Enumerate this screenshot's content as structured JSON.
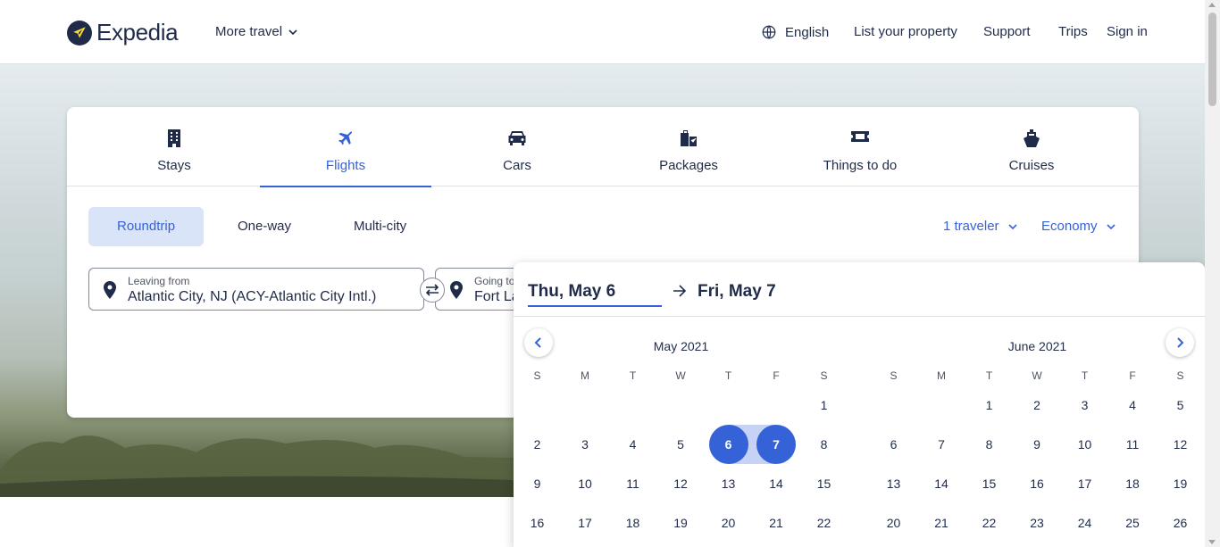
{
  "header": {
    "logo_text": "Expedia",
    "more_travel": "More travel",
    "language": "English",
    "list_property": "List your property",
    "support": "Support",
    "trips": "Trips",
    "sign_in": "Sign in"
  },
  "tabs": [
    {
      "label": "Stays",
      "icon": "building-icon"
    },
    {
      "label": "Flights",
      "icon": "plane-icon",
      "active": true
    },
    {
      "label": "Cars",
      "icon": "car-icon"
    },
    {
      "label": "Packages",
      "icon": "packages-icon"
    },
    {
      "label": "Things to do",
      "icon": "ticket-icon"
    },
    {
      "label": "Cruises",
      "icon": "ship-icon"
    }
  ],
  "trip_types": {
    "roundtrip": "Roundtrip",
    "oneway": "One-way",
    "multicity": "Multi-city"
  },
  "options": {
    "travelers": "1 traveler",
    "cabin": "Economy"
  },
  "leaving": {
    "label": "Leaving from",
    "value": "Atlantic City, NJ (ACY-Atlantic City Intl.)"
  },
  "going": {
    "label": "Going to",
    "value": "Fort Lauderdale"
  },
  "picker": {
    "start_date": "Thu, May 6",
    "end_date": "Fri, May 7",
    "weekdays": [
      "S",
      "M",
      "T",
      "W",
      "T",
      "F",
      "S"
    ],
    "months": [
      {
        "title": "May 2021",
        "weeks": [
          [
            "",
            "",
            "",
            "",
            "",
            "",
            "1"
          ],
          [
            "2",
            "3",
            "4",
            "5",
            "6",
            "7",
            "8"
          ],
          [
            "9",
            "10",
            "11",
            "12",
            "13",
            "14",
            "15"
          ],
          [
            "16",
            "17",
            "18",
            "19",
            "20",
            "21",
            "22"
          ]
        ]
      },
      {
        "title": "June 2021",
        "weeks": [
          [
            "",
            "",
            "1",
            "2",
            "3",
            "4",
            "5"
          ],
          [
            "6",
            "7",
            "8",
            "9",
            "10",
            "11",
            "12"
          ],
          [
            "13",
            "14",
            "15",
            "16",
            "17",
            "18",
            "19"
          ],
          [
            "20",
            "21",
            "22",
            "23",
            "24",
            "25",
            "26"
          ]
        ]
      }
    ]
  },
  "colors": {
    "accent": "#3662d8",
    "accent_light": "#dae4f8",
    "text": "#1f2b49"
  }
}
